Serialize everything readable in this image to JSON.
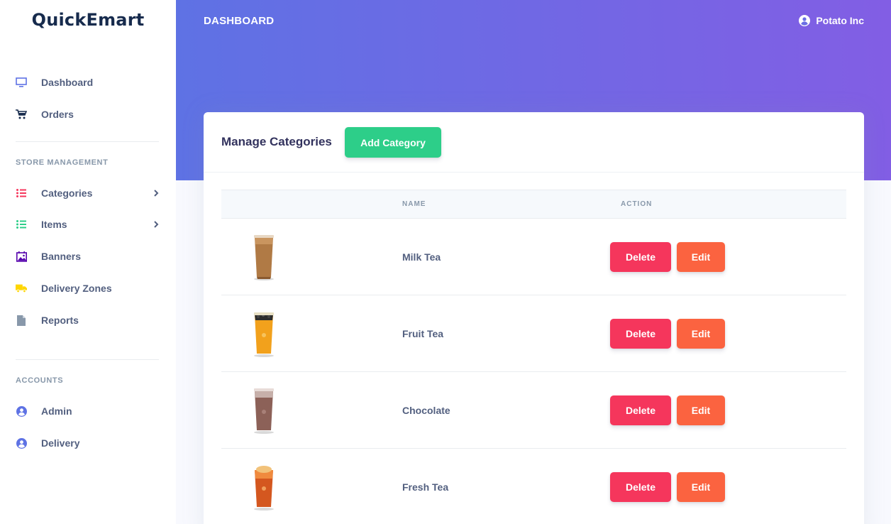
{
  "brand": "QuickEmart",
  "header": {
    "title": "DASHBOARD",
    "user": "Potato Inc"
  },
  "sidebar": {
    "main_items": [
      {
        "label": "Dashboard",
        "icon": "monitor-icon",
        "color": "#5e72e4"
      },
      {
        "label": "Orders",
        "icon": "cart-icon",
        "color": "#172b4d"
      }
    ],
    "store_heading": "STORE MANAGEMENT",
    "store_items": [
      {
        "label": "Categories",
        "icon": "list-icon",
        "color": "#f5365c"
      },
      {
        "label": "Items",
        "icon": "list-icon",
        "color": "#2dce89"
      },
      {
        "label": "Banners",
        "icon": "image-icon",
        "color": "#5603ad"
      },
      {
        "label": "Delivery Zones",
        "icon": "truck-icon",
        "color": "#ffd600"
      },
      {
        "label": "Reports",
        "icon": "file-icon",
        "color": "#8898aa"
      }
    ],
    "accounts_heading": "ACCOUNTS",
    "account_items": [
      {
        "label": "Admin",
        "icon": "user-circle-icon",
        "color": "#5e72e4"
      },
      {
        "label": "Delivery",
        "icon": "user-circle-icon",
        "color": "#5e72e4"
      }
    ]
  },
  "card": {
    "title": "Manage Categories",
    "add_button": "Add Category",
    "columns": [
      "",
      "NAME",
      "ACTION"
    ],
    "delete_label": "Delete",
    "edit_label": "Edit",
    "rows": [
      {
        "name": "Milk Tea",
        "drink_color": "#b07a45"
      },
      {
        "name": "Fruit Tea",
        "drink_color": "#f2a11c"
      },
      {
        "name": "Chocolate",
        "drink_color": "#8c6158"
      },
      {
        "name": "Fresh Tea",
        "drink_color": "#d4571f"
      }
    ]
  }
}
